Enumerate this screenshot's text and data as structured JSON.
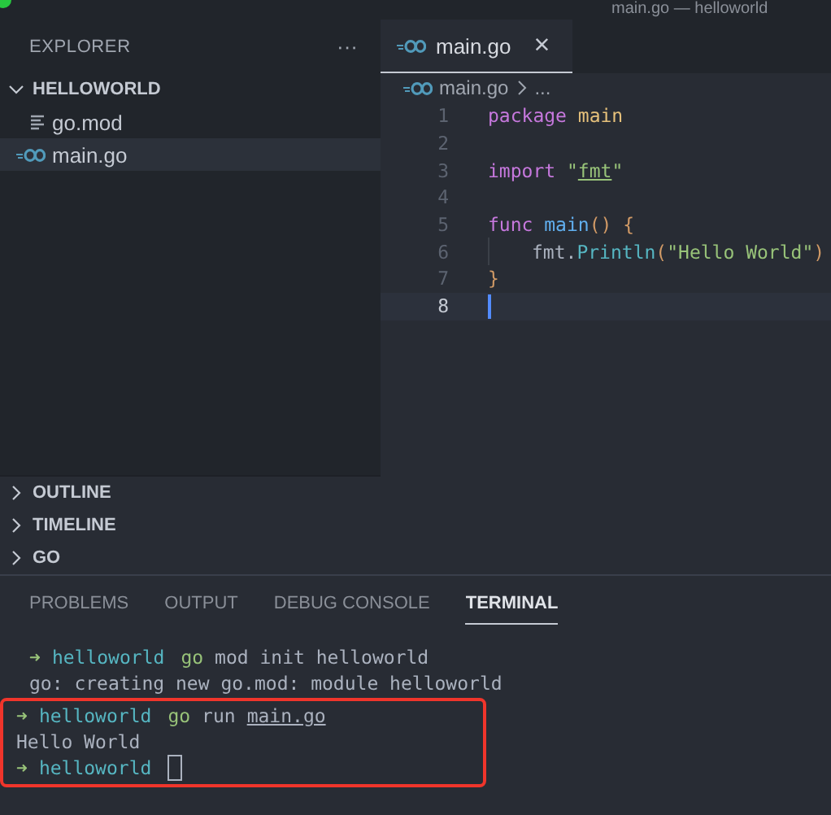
{
  "window": {
    "title": "main.go — helloworld"
  },
  "sidebar": {
    "title": "EXPLORER",
    "more": "···",
    "folder": {
      "label": "HELLOWORLD",
      "expanded": true,
      "files": [
        {
          "name": "go.mod",
          "kind": "text",
          "selected": false
        },
        {
          "name": "main.go",
          "kind": "go",
          "selected": true
        }
      ]
    },
    "sections": [
      {
        "label": "OUTLINE",
        "expanded": false
      },
      {
        "label": "TIMELINE",
        "expanded": false
      },
      {
        "label": "GO",
        "expanded": false
      }
    ]
  },
  "editor": {
    "tabs": [
      {
        "label": "main.go",
        "kind": "go",
        "selected": true,
        "close": "×"
      }
    ],
    "breadcrumb": {
      "file": "main.go",
      "rest": "..."
    },
    "lines": [
      {
        "number": "1",
        "current": false,
        "indented": false,
        "tokens": [
          {
            "kind": "kw",
            "text": "package"
          },
          {
            "kind": "type",
            "text": "main"
          }
        ]
      },
      {
        "number": "2",
        "current": false,
        "indented": false
      },
      {
        "number": "3",
        "current": false,
        "indented": false,
        "tokens": [
          {
            "kind": "kw",
            "text": "import"
          },
          {
            "kind": "str",
            "text": "\""
          },
          {
            "kind": "pkg",
            "text": "fmt"
          },
          {
            "kind": "str",
            "text": "\""
          }
        ]
      },
      {
        "number": "4",
        "current": false,
        "indented": false
      },
      {
        "number": "5",
        "current": false,
        "indented": false,
        "tokens": [
          {
            "kind": "kw",
            "text": "func"
          },
          {
            "kind": "fn",
            "text": "main"
          },
          {
            "kind": "pun",
            "text": "() {"
          }
        ]
      },
      {
        "number": "6",
        "current": false,
        "indented": true,
        "tokens": [
          {
            "kind": "plain",
            "text": "fmt."
          },
          {
            "kind": "call",
            "text": "Println"
          },
          {
            "kind": "pun",
            "text": "("
          },
          {
            "kind": "str",
            "text": "\"Hello World\""
          },
          {
            "kind": "pun",
            "text": ")"
          }
        ]
      },
      {
        "number": "7",
        "current": false,
        "indented": false,
        "tokens": [
          {
            "kind": "pun",
            "text": "}"
          }
        ]
      },
      {
        "number": "8",
        "current": true,
        "indented": false
      }
    ]
  },
  "panel": {
    "tabs": [
      {
        "label": "PROBLEMS",
        "selected": false
      },
      {
        "label": "OUTPUT",
        "selected": false
      },
      {
        "label": "DEBUG CONSOLE",
        "selected": false
      },
      {
        "label": "TERMINAL",
        "selected": true
      }
    ],
    "terminal": [
      {
        "highlighted": false,
        "segments": [
          {
            "kind": "arrow",
            "text": "➜"
          },
          {
            "kind": "dir",
            "text": "helloworld"
          },
          {
            "kind": "cmd",
            "text": "go"
          },
          {
            "kind": "text",
            "text": "mod init helloworld"
          }
        ]
      },
      {
        "highlighted": false,
        "segments": [
          {
            "kind": "text",
            "text": "go: creating new go.mod: module helloworld"
          }
        ]
      },
      {
        "highlighted": true,
        "segments": [
          {
            "kind": "arrow",
            "text": "➜"
          },
          {
            "kind": "dir",
            "text": "helloworld"
          },
          {
            "kind": "cmd",
            "text": "go"
          },
          {
            "kind": "text",
            "text": "run"
          },
          {
            "kind": "link",
            "text": "main.go"
          }
        ]
      },
      {
        "highlighted": true,
        "segments": [
          {
            "kind": "text",
            "text": "Hello World"
          }
        ]
      },
      {
        "highlighted": true,
        "segments": [
          {
            "kind": "arrow",
            "text": "➜"
          },
          {
            "kind": "dir",
            "text": "helloworld"
          },
          {
            "kind": "cursor"
          }
        ]
      }
    ]
  }
}
